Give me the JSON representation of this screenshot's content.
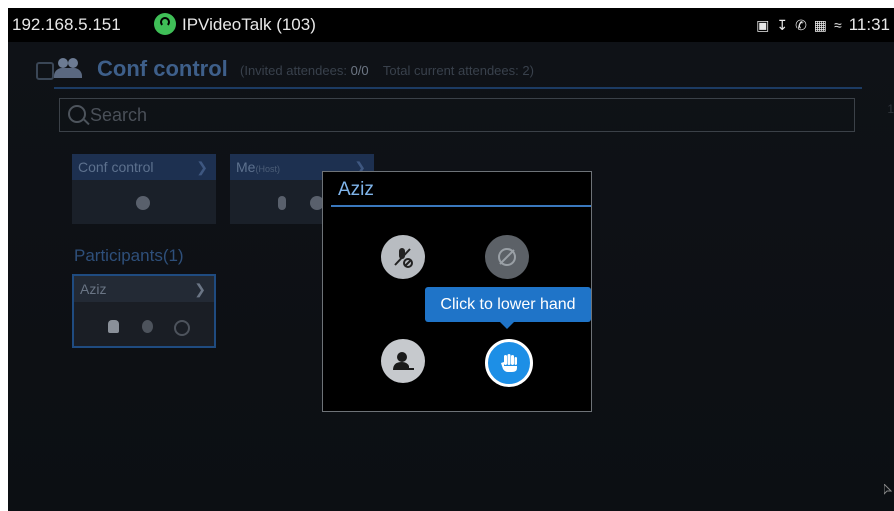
{
  "status_bar": {
    "ip": "192.168.5.151",
    "account": "IPVideoTalk (103)",
    "time": "11:31",
    "icons": [
      "image-icon",
      "download-icon",
      "call-icon",
      "sim-icon",
      "wifi-icon"
    ]
  },
  "conf": {
    "title": "Conf control",
    "invited_label": "(Invited attendees:",
    "invited_value": "0/0",
    "total_label": "Total current attendees:",
    "total_value": "2)"
  },
  "search": {
    "placeholder": "Search"
  },
  "side_label": "1",
  "cards": {
    "conf_control": "Conf control",
    "me": "Me",
    "me_suffix": "(Host)"
  },
  "participants": {
    "label": "Participants(1)",
    "items": [
      {
        "name": "Aziz"
      }
    ]
  },
  "modal": {
    "title": "Aziz",
    "tooltip": "Click to lower hand",
    "buttons": [
      "mute-icon",
      "video-off-icon",
      "remove-participant-icon",
      "raised-hand-icon"
    ]
  },
  "colors": {
    "accent": "#1d8fe6",
    "modal_title": "#7fb4ea",
    "call_green": "#3fbf57"
  }
}
